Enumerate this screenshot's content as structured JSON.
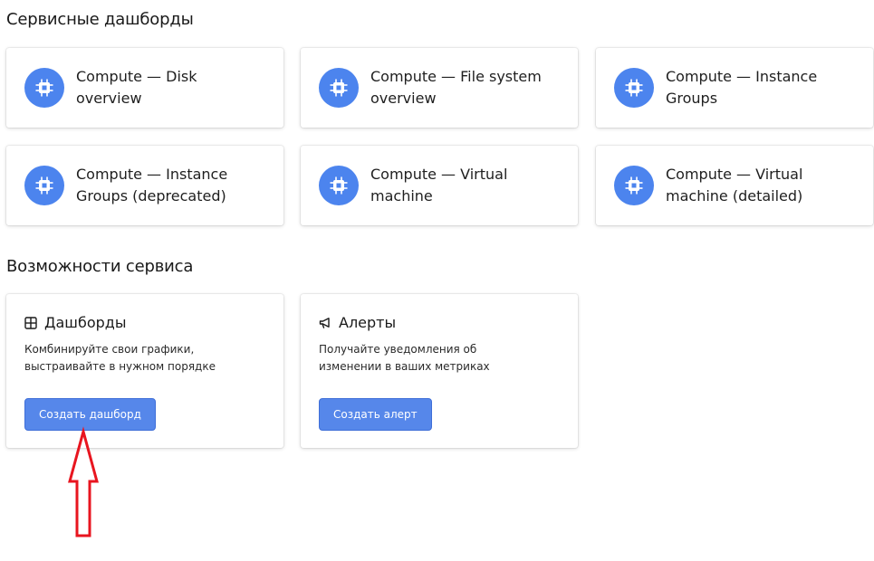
{
  "service_dashboards": {
    "title": "Сервисные дашборды",
    "items": [
      {
        "label": "Compute — Disk overview"
      },
      {
        "label": "Compute — File system overview"
      },
      {
        "label": "Compute — Instance Groups"
      },
      {
        "label": "Compute — Instance Groups (deprecated)"
      },
      {
        "label": "Compute — Virtual machine"
      },
      {
        "label": "Compute — Virtual machine (detailed)"
      }
    ],
    "icon": "cpu-chip-icon",
    "icon_color": "#4c84ee"
  },
  "features": {
    "title": "Возможности сервиса",
    "dashboards": {
      "title": "Дашборды",
      "icon": "grid-icon",
      "description": "Комбинируйте свои графики, выстраивайте в нужном порядке",
      "button": "Создать дашборд"
    },
    "alerts": {
      "title": "Алерты",
      "icon": "megaphone-icon",
      "description": "Получайте уведомления об изменении в ваших метриках",
      "button": "Создать алерт"
    }
  },
  "annotation": {
    "arrow_color": "#e8151f",
    "arrow_icon": "up-arrow-annotation"
  }
}
